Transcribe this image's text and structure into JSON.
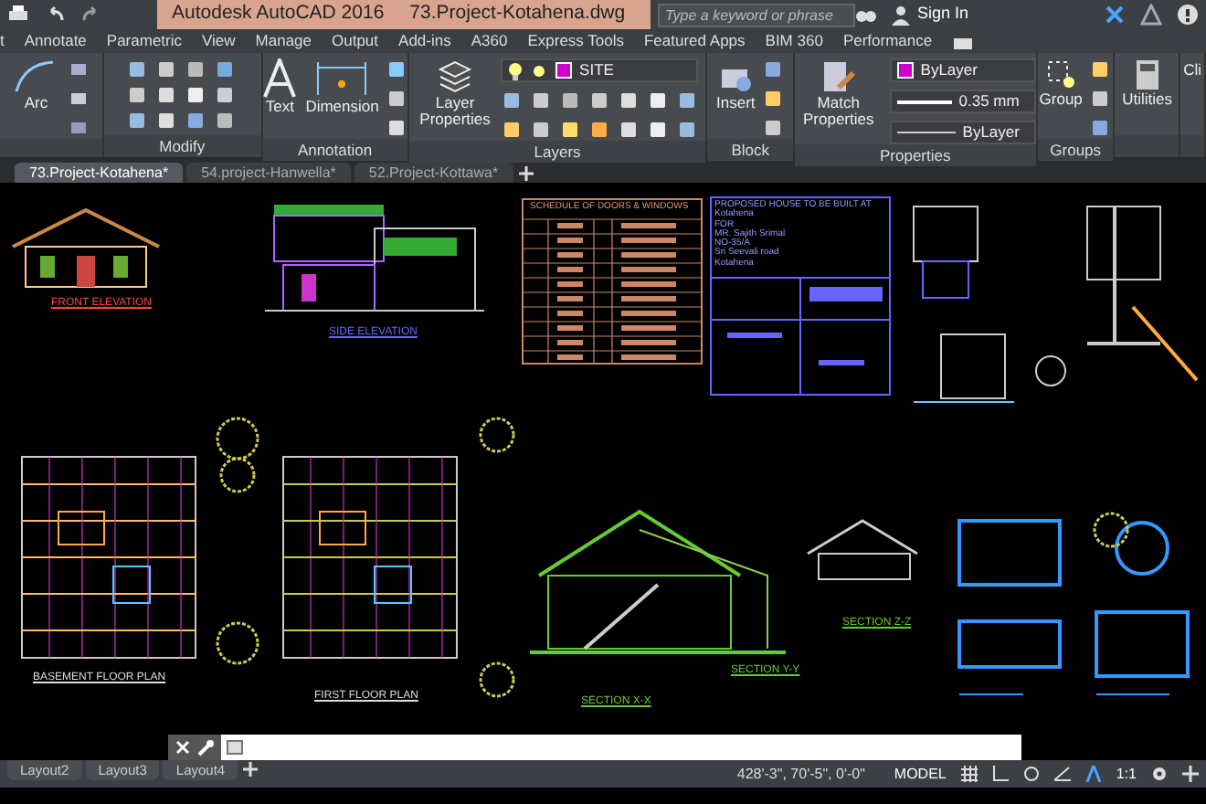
{
  "title_bar": {
    "app_title": "Autodesk AutoCAD 2016",
    "file_name": "73.Project-Kotahena.dwg",
    "search": {
      "placeholder": "Type a keyword or phrase"
    },
    "sign_in": "Sign In"
  },
  "menu_tabs": [
    "t",
    "Annotate",
    "Parametric",
    "View",
    "Manage",
    "Output",
    "Add-ins",
    "A360",
    "Express Tools",
    "Featured Apps",
    "BIM 360",
    "Performance"
  ],
  "ribbon": {
    "draw_tool": "Arc",
    "modify_title": "Modify",
    "text_tool": "Text",
    "dimension_tool": "Dimension",
    "annotation_title": "Annotation",
    "layer_properties": "Layer Properties",
    "layer": {
      "name": "SITE",
      "color": "#cc00cc"
    },
    "layers_title": "Layers",
    "insert_tool": "Insert",
    "block_title": "Block",
    "match_properties": "Match Properties",
    "color_value": "ByLayer",
    "lineweight_value": "0.35 mm",
    "linetype_value": "ByLayer",
    "properties_title": "Properties",
    "group_tool": "Group",
    "groups_title": "Groups",
    "utilities_tool": "Utilities",
    "clipboard_tool": "Cli"
  },
  "doc_tabs": [
    {
      "label": "73.Project-Kotahena*",
      "selected": true
    },
    {
      "label": "54.project-Hanwella*",
      "selected": false
    },
    {
      "label": "52.Project-Kottawa*",
      "selected": false
    }
  ],
  "drawing_labels": [
    "FRONT ELEVATION",
    "SIDE ELEVATION",
    "BASEMENT FLOOR PLAN",
    "FIRST FLOOR PLAN",
    "SECTION X-X",
    "SECTION Y-Y",
    "SECTION Z-Z"
  ],
  "schedule_title": "SCHEDULE OF DOORS & WINDOWS",
  "title_block": [
    "PROPOSED HOUSE TO BE BUILT AT",
    "Kotahena",
    "FOR",
    "MR. Sajith Srimal",
    "NO-35/A",
    "Sri Seevali road",
    "Kotahena"
  ],
  "layout_tabs": [
    "Layout2",
    "Layout3",
    "Layout4"
  ],
  "status_bar": {
    "coordinates": "428'-3\", 70'-5\", 0'-0\"",
    "space": "MODEL",
    "scale": "1:1"
  }
}
